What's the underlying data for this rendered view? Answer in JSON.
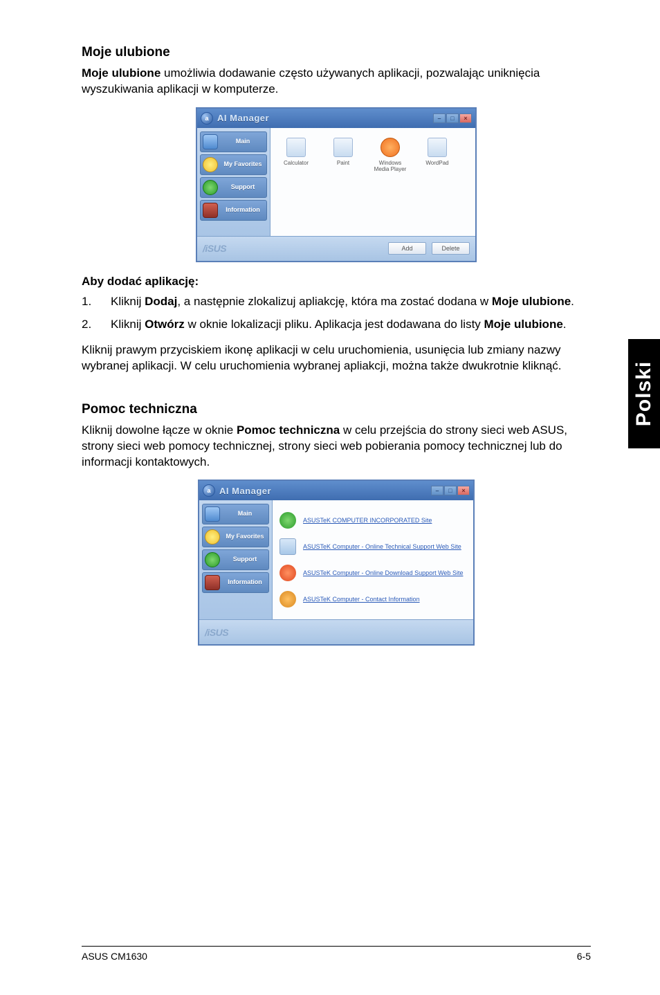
{
  "side_tab": "Polski",
  "section1": {
    "title": "Moje ulubione",
    "intro_bold": "Moje ulubione",
    "intro_rest": " umożliwia dodawanie często używanych aplikacji, pozwalając uniknięcia wyszukiwania aplikacji w komputerze.",
    "subhead": "Aby dodać aplikację:",
    "steps": [
      {
        "num": "1.",
        "pre": "Kliknij ",
        "b1": "Dodaj",
        "mid": ", a następnie zlokalizuj apliakcję, która ma zostać dodana w ",
        "b2": "Moje ulubione",
        "post": "."
      },
      {
        "num": "2.",
        "pre": "Kliknij ",
        "b1": "Otwórz",
        "mid": " w oknie lokalizacji pliku. Aplikacja jest dodawana do listy ",
        "b2": "Moje ulubione",
        "post": "."
      }
    ],
    "para": "Kliknij prawym przyciskiem ikonę aplikacji w celu uruchomienia, usunięcia lub zmiany nazwy wybranej aplikacji. W celu uruchomienia wybranej apliakcji, można także dwukrotnie kliknąć."
  },
  "section2": {
    "title": "Pomoc techniczna",
    "intro_pre": "Kliknij dowolne łącze w oknie ",
    "intro_bold": "Pomoc techniczna",
    "intro_post": " w celu przejścia do strony sieci web ASUS, strony sieci web pomocy technicznej, strony sieci web pobierania pomocy technicznej lub do informacji kontaktowych."
  },
  "ai_window": {
    "title": "AI Manager",
    "logo_glyph": "a",
    "sidebar": [
      {
        "label": "Main",
        "iconClass": "main"
      },
      {
        "label": "My Favorites",
        "iconClass": "fav"
      },
      {
        "label": "Support",
        "iconClass": "sup"
      },
      {
        "label": "Information",
        "iconClass": "info"
      }
    ],
    "favorites": [
      {
        "label": "Calculator"
      },
      {
        "label": "Paint"
      },
      {
        "label": "Windows Media Player"
      },
      {
        "label": "WordPad"
      }
    ],
    "footer_brand": "/iSUS",
    "buttons": {
      "add": "Add",
      "delete": "Delete"
    },
    "support_links": [
      "ASUSTeK COMPUTER INCORPORATED Site",
      "ASUSTeK Computer - Online Technical Support Web Site",
      "ASUSTeK Computer - Online Download Support Web Site",
      "ASUSTeK Computer - Contact Information"
    ]
  },
  "footer": {
    "left": "ASUS CM1630",
    "right": "6-5"
  }
}
